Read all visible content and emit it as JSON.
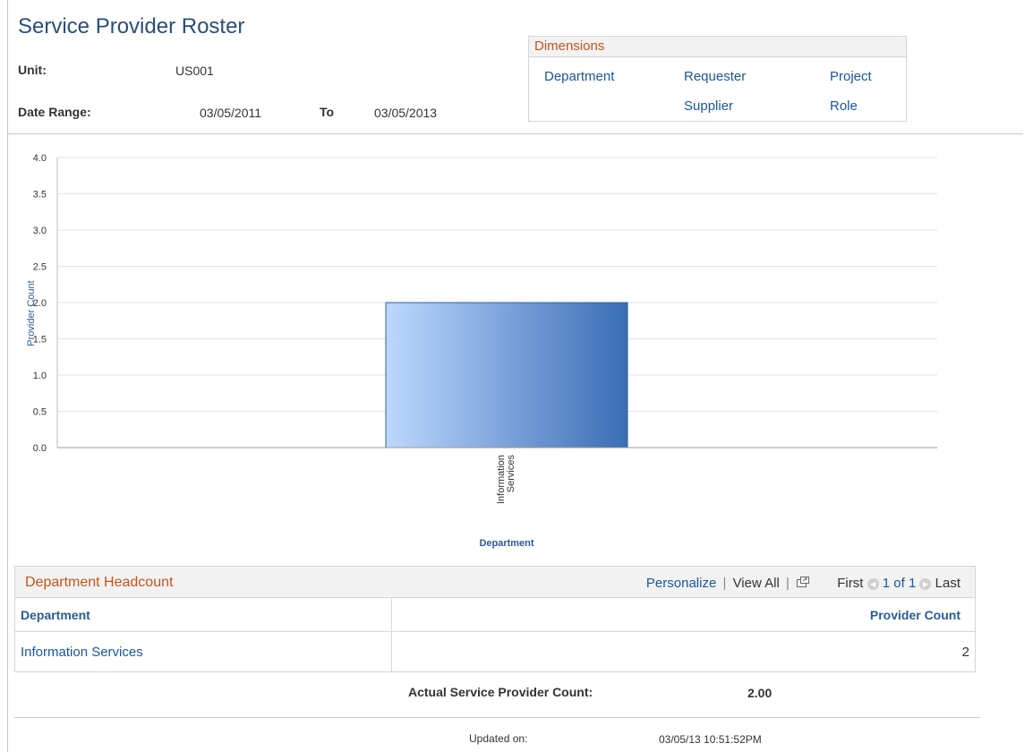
{
  "page": {
    "title": "Service Provider Roster"
  },
  "filters": {
    "unit_label": "Unit:",
    "unit_value": "US001",
    "date_range_label": "Date Range:",
    "date_from": "03/05/2011",
    "to_label": "To",
    "date_to": "03/05/2013"
  },
  "dimensions": {
    "title": "Dimensions",
    "links": [
      "Department",
      "Requester",
      "Project",
      "Supplier",
      "Role"
    ]
  },
  "chart_data": {
    "type": "bar",
    "categories": [
      "Information Services"
    ],
    "category_lines": [
      [
        "Information",
        "Services"
      ]
    ],
    "values": [
      2
    ],
    "xlabel": "Department",
    "ylabel": "Provider Count",
    "ylim": [
      0,
      4
    ],
    "yticks": [
      "0.0",
      "0.5",
      "1.0",
      "1.5",
      "2.0",
      "2.5",
      "3.0",
      "3.5",
      "4.0"
    ],
    "grid": true,
    "colors": {
      "bar_light": "#bdd8ff",
      "bar_dark": "#3a6db5",
      "axis_label": "#2b5b95"
    }
  },
  "grid": {
    "title": "Department Headcount",
    "personalize": "Personalize",
    "sep": "|",
    "view_all": "View All",
    "first": "First",
    "pagination": "1 of 1",
    "last": "Last",
    "columns": [
      "Department",
      "Provider Count"
    ],
    "rows": [
      {
        "department": "Information Services",
        "count": "2"
      }
    ]
  },
  "summary": {
    "label": "Actual Service Provider Count:",
    "value": "2.00",
    "updated_label": "Updated on:",
    "updated_value": "03/05/13 10:51:52PM"
  },
  "colors": {
    "link": "#1a56a0",
    "section_title": "#c2561a",
    "header_bg": "#f2f2f2"
  }
}
